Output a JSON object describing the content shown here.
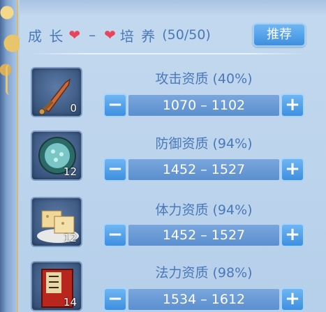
{
  "header": {
    "left_label": "成 长",
    "right_label": "培 养",
    "count": "(50/50)",
    "recommend_button": "推荐"
  },
  "rows": [
    {
      "icon": "sword-icon",
      "count": "0",
      "label": "攻击资质 (40%)",
      "range": "1070 – 1102"
    },
    {
      "icon": "gem-bundle-icon",
      "count": "12",
      "label": "防御资质 (94%)",
      "range": "1452 – 1527"
    },
    {
      "icon": "pastry-icon",
      "count": "12",
      "label": "体力资质 (94%)",
      "range": "1452 – 1527"
    },
    {
      "icon": "book-icon",
      "count": "14",
      "label": "法力资质 (98%)",
      "range": "1534 – 1612"
    }
  ],
  "colors": {
    "accent_text": "#4a78b8",
    "button_blue": "#3f8fe0",
    "heart": "#e8455a"
  }
}
